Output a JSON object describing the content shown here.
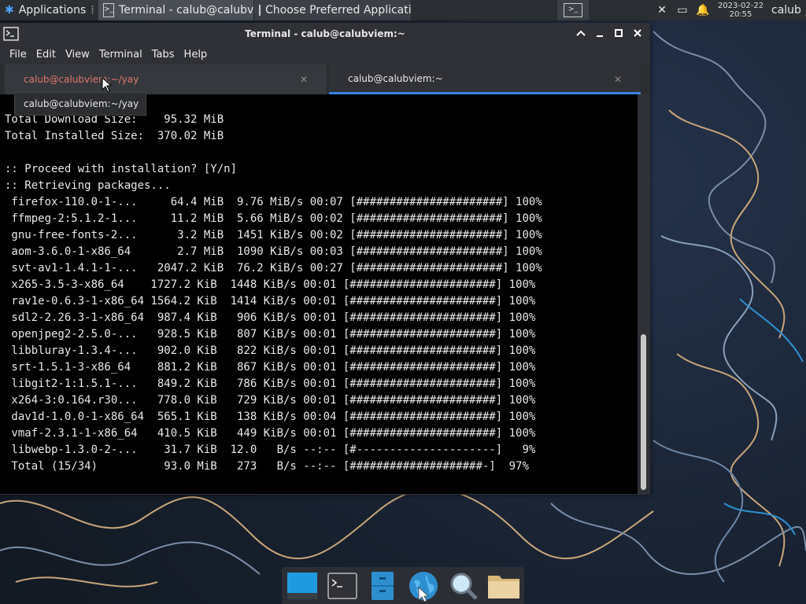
{
  "top_panel": {
    "applications_label": "Applications",
    "tasks": [
      {
        "label": "Terminal - calub@calubviem:~"
      },
      {
        "label": "Choose Preferred Application"
      }
    ],
    "clock_date": "2023-02-22",
    "clock_time": "20:55",
    "user_label": "calub"
  },
  "window": {
    "title": "Terminal - calub@calubviem:~"
  },
  "menu": [
    "File",
    "Edit",
    "View",
    "Terminal",
    "Tabs",
    "Help"
  ],
  "tabs": [
    {
      "label": "calub@calubviem:~/yay",
      "active": false
    },
    {
      "label": "calub@calubviem:~",
      "active": true
    }
  ],
  "tooltip": "calub@calubviem:~/yay",
  "terminal_lines": [
    "Total Download Size:    95.32 MiB",
    "Total Installed Size:  370.02 MiB",
    "",
    ":: Proceed with installation? [Y/n]",
    ":: Retrieving packages...",
    " firefox-110.0-1-...     64.4 MiB  9.76 MiB/s 00:07 [######################] 100%",
    " ffmpeg-2:5.1.2-1...     11.2 MiB  5.66 MiB/s 00:02 [######################] 100%",
    " gnu-free-fonts-2...      3.2 MiB  1451 KiB/s 00:02 [######################] 100%",
    " aom-3.6.0-1-x86_64       2.7 MiB  1090 KiB/s 00:03 [######################] 100%",
    " svt-av1-1.4.1-1-...   2047.2 KiB  76.2 KiB/s 00:27 [######################] 100%",
    " x265-3.5-3-x86_64    1727.2 KiB  1448 KiB/s 00:01 [######################] 100%",
    " rav1e-0.6.3-1-x86_64 1564.2 KiB  1414 KiB/s 00:01 [######################] 100%",
    " sdl2-2.26.3-1-x86_64  987.4 KiB   906 KiB/s 00:01 [######################] 100%",
    " openjpeg2-2.5.0-...   928.5 KiB   807 KiB/s 00:01 [######################] 100%",
    " libbluray-1.3.4-...   902.0 KiB   822 KiB/s 00:01 [######################] 100%",
    " srt-1.5.1-3-x86_64    881.2 KiB   867 KiB/s 00:01 [######################] 100%",
    " libgit2-1:1.5.1-...   849.2 KiB   786 KiB/s 00:01 [######################] 100%",
    " x264-3:0.164.r30...   778.0 KiB   729 KiB/s 00:01 [######################] 100%",
    " dav1d-1.0.0-1-x86_64  565.1 KiB   138 KiB/s 00:04 [######################] 100%",
    " vmaf-2.3.1-1-x86_64   410.5 KiB   449 KiB/s 00:01 [######################] 100%",
    " libwebp-1.3.0-2-...    31.7 KiB  12.0   B/s --:-- [#---------------------]   9%",
    " Total (15/34)          93.0 MiB   273   B/s --:-- [####################-]  97%"
  ],
  "dock": [
    {
      "icon": "show-desktop-icon"
    },
    {
      "icon": "terminal-icon"
    },
    {
      "icon": "file-manager-icon"
    },
    {
      "icon": "web-browser-icon"
    },
    {
      "icon": "app-finder-icon"
    },
    {
      "icon": "folder-icon"
    }
  ],
  "colors": {
    "accent": "#3584e4",
    "inactive_tab_text": "#e0776e",
    "terminal_bg": "#000000"
  }
}
